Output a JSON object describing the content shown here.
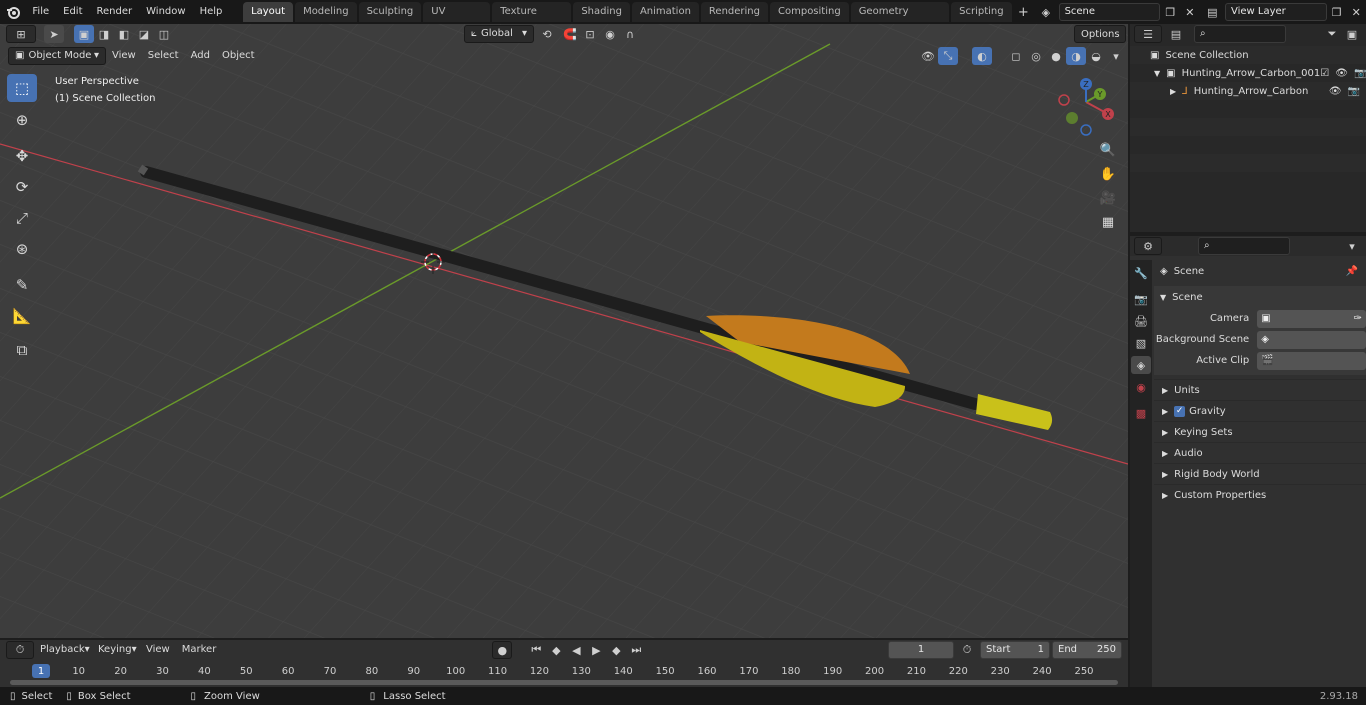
{
  "topbar": {
    "menus": [
      "File",
      "Edit",
      "Render",
      "Window",
      "Help"
    ],
    "tabs": [
      "Layout",
      "Modeling",
      "Sculpting",
      "UV Editing",
      "Texture Paint",
      "Shading",
      "Animation",
      "Rendering",
      "Compositing",
      "Geometry Nodes",
      "Scripting"
    ],
    "active_tab": "Layout",
    "add_tab": "+",
    "scene_name": "Scene",
    "view_layer": "View Layer"
  },
  "viewport": {
    "mode": "Object Mode",
    "menus": [
      "View",
      "Select",
      "Add",
      "Object"
    ],
    "orientation": "Global",
    "options": "Options",
    "overlay_title": "User Perspective",
    "overlay_sub": "(1) Scene Collection",
    "gizmo": {
      "x": "X",
      "y": "Y",
      "z": "Z"
    }
  },
  "outliner": {
    "root": "Scene Collection",
    "items": [
      {
        "label": "Hunting_Arrow_Carbon_001"
      },
      {
        "label": "Hunting_Arrow_Carbon"
      }
    ]
  },
  "properties": {
    "header": "Scene",
    "section": "Scene",
    "fields": [
      {
        "label": "Camera"
      },
      {
        "label": "Background Scene"
      },
      {
        "label": "Active Clip"
      }
    ],
    "panels": [
      "Units",
      "Gravity",
      "Keying Sets",
      "Audio",
      "Rigid Body World",
      "Custom Properties"
    ]
  },
  "timeline": {
    "menus": [
      "Playback",
      "Keying",
      "View",
      "Marker"
    ],
    "current_frame": "1",
    "start_label": "Start",
    "start": "1",
    "end_label": "End",
    "end": "250",
    "ticks": [
      "1",
      "10",
      "20",
      "30",
      "40",
      "50",
      "60",
      "70",
      "80",
      "90",
      "100",
      "110",
      "120",
      "130",
      "140",
      "150",
      "160",
      "170",
      "180",
      "190",
      "200",
      "210",
      "220",
      "230",
      "240",
      "250"
    ]
  },
  "statusbar": {
    "items": [
      "Select",
      "Box Select",
      "Zoom View",
      "Lasso Select"
    ],
    "version": "2.93.18"
  },
  "colors": {
    "accent": "#4772b3",
    "x_axis": "#c0414b",
    "y_axis": "#6a9a2a",
    "fletch_orange": "#c37a1d",
    "fletch_yellow": "#c2b314"
  }
}
